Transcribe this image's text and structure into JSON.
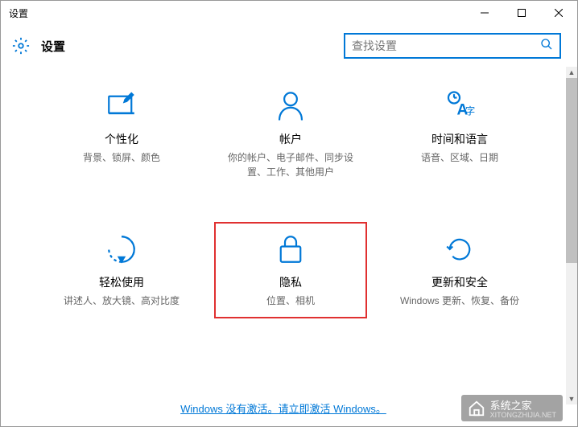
{
  "window": {
    "title": "设置"
  },
  "header": {
    "title": "设置",
    "search_placeholder": "查找设置"
  },
  "tiles": [
    {
      "title": "个性化",
      "desc": "背景、锁屏、颜色"
    },
    {
      "title": "帐户",
      "desc": "你的帐户、电子邮件、同步设置、工作、其他用户"
    },
    {
      "title": "时间和语言",
      "desc": "语音、区域、日期"
    },
    {
      "title": "轻松使用",
      "desc": "讲述人、放大镜、高对比度"
    },
    {
      "title": "隐私",
      "desc": "位置、相机"
    },
    {
      "title": "更新和安全",
      "desc": "Windows 更新、恢复、备份"
    }
  ],
  "footer": {
    "activate_text": "Windows 没有激活。请立即激活 Windows。"
  },
  "watermark": {
    "text": "系统之家",
    "url": "XITONGZHIJIA.NET"
  }
}
